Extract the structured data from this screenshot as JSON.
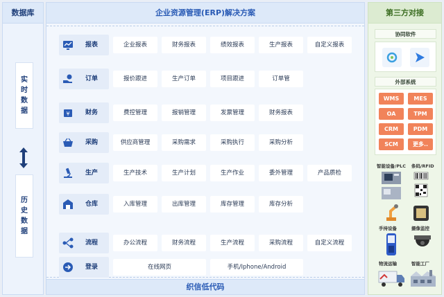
{
  "database": {
    "title": "数据库",
    "realtime_label": "实时数据",
    "history_label": "历史数据"
  },
  "erp": {
    "title": "企业资源管理(ERP)解决方案",
    "footer": "织信低代码",
    "modules": [
      {
        "name": "报表",
        "icon": "chart-screen-icon",
        "items": [
          "企业报表",
          "财务报表",
          "绩效报表",
          "生产报表",
          "自定义报表"
        ]
      },
      {
        "name": "订单",
        "icon": "order-hand-icon",
        "items": [
          "报价跟进",
          "生产订单",
          "项目跟进",
          "订单管"
        ]
      },
      {
        "name": "财务",
        "icon": "finance-icon",
        "items": [
          "费控管理",
          "报销管理",
          "发票管理",
          "财务报表"
        ]
      },
      {
        "name": "采购",
        "icon": "basket-icon",
        "items": [
          "供应商管理",
          "采购需求",
          "采购执行",
          "采购分析"
        ]
      },
      {
        "name": "生产",
        "icon": "microscope-icon",
        "items": [
          "生产技术",
          "生产计划",
          "生产作业",
          "委外管理",
          "产品质检"
        ]
      },
      {
        "name": "仓库",
        "icon": "warehouse-icon",
        "items": [
          "入库管理",
          "出库管理",
          "库存管理",
          "库存分析"
        ]
      },
      {
        "name": "流程",
        "icon": "flow-icon",
        "items": [
          "办公流程",
          "财务流程",
          "生产流程",
          "采购流程",
          "自定义流程"
        ]
      },
      {
        "name": "登录",
        "icon": "login-arrow-icon",
        "items": [
          "在线网页",
          "手机/Iphone/Android"
        ]
      }
    ]
  },
  "third_party": {
    "title": "第三方对接",
    "software_title": "协同软件",
    "external_title": "外部系统",
    "systems": [
      "WMS",
      "MES",
      "OA",
      "TPM",
      "CRM",
      "PDM",
      "SCM",
      "更多.."
    ],
    "devices": [
      "智能设备/PLC",
      "条码/RFID",
      "手持设备",
      "摄像监控",
      "物流运输",
      "智能工厂"
    ]
  },
  "colors": {
    "accent": "#2a5bb5",
    "orange": "#f1835a",
    "green_title": "#3b6d21"
  }
}
